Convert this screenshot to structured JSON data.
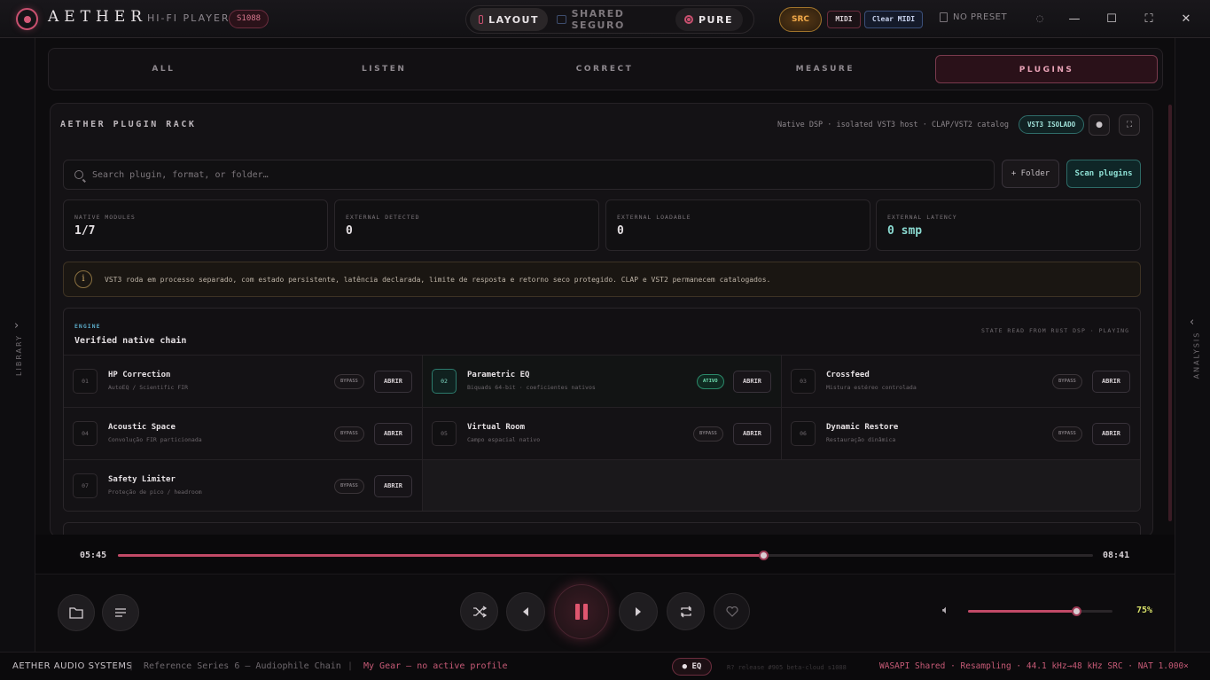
{
  "app": {
    "brand": "AETHER",
    "subtitle": "HI-FI PLAYER",
    "version": "S1088",
    "modes": {
      "layout": "LAYOUT",
      "shared": "SHARED SEGURO",
      "pure": "PURE"
    },
    "src": "SRC",
    "midi": "MIDI",
    "clear_midi": "Clear MIDI",
    "preset": "NO PRESET",
    "window": {
      "minimize": "—",
      "maximize": "☐",
      "fullscreen": "⛶",
      "close": "✕"
    }
  },
  "rails": {
    "left_label": "LIBRARY",
    "right_label": "ANALYSIS"
  },
  "tabs": [
    {
      "label": "ALL",
      "active": false
    },
    {
      "label": "LISTEN",
      "active": false
    },
    {
      "label": "CORRECT",
      "active": false
    },
    {
      "label": "MEASURE",
      "active": false
    },
    {
      "label": "PLUGINS",
      "active": true
    }
  ],
  "rack": {
    "title": "AETHER PLUGIN RACK",
    "meta": "Native DSP · isolated VST3 host · CLAP/VST2 catalog",
    "badge": "VST3 ISOLADO",
    "search_placeholder": "Search plugin, format, or folder…",
    "folder_btn": "+ Folder",
    "scan_btn": "Scan plugins",
    "stats": [
      {
        "label": "NATIVE MODULES",
        "value": "1/7"
      },
      {
        "label": "EXTERNAL DETECTED",
        "value": "0"
      },
      {
        "label": "EXTERNAL LOADABLE",
        "value": "0"
      },
      {
        "label": "EXTERNAL LATENCY",
        "value": "0 smp"
      }
    ],
    "notice": "VST3 roda em processo separado, com estado persistente, latência declarada, limite de resposta e retorno seco protegido. CLAP e VST2 permanecem catalogados.",
    "chain": {
      "eyebrow": "ENGINE",
      "title": "Verified native chain",
      "state": "STATE READ FROM RUST DSP · PLAYING",
      "modules": [
        {
          "num": "01",
          "name": "HP Correction",
          "desc": "AutoEQ / Scientific FIR",
          "status": "BYPASS",
          "open": "ABRIR",
          "active": false
        },
        {
          "num": "02",
          "name": "Parametric EQ",
          "desc": "Biquads 64-bit · coeficientes nativos",
          "status": "ATIVO",
          "open": "ABRIR",
          "active": true
        },
        {
          "num": "03",
          "name": "Crossfeed",
          "desc": "Mistura estéreo controlada",
          "status": "BYPASS",
          "open": "ABRIR",
          "active": false
        },
        {
          "num": "04",
          "name": "Acoustic Space",
          "desc": "Convolução FIR particionada",
          "status": "BYPASS",
          "open": "ABRIR",
          "active": false
        },
        {
          "num": "05",
          "name": "Virtual Room",
          "desc": "Campo espacial nativo",
          "status": "BYPASS",
          "open": "ABRIR",
          "active": false
        },
        {
          "num": "06",
          "name": "Dynamic Restore",
          "desc": "Restauração dinâmica",
          "status": "BYPASS",
          "open": "ABRIR",
          "active": false
        },
        {
          "num": "07",
          "name": "Safety Limiter",
          "desc": "Proteção de pico / headroom",
          "status": "BYPASS",
          "open": "ABRIR",
          "active": false
        }
      ]
    }
  },
  "transport": {
    "elapsed": "05:45",
    "total": "08:41",
    "progress": 0.662,
    "volume": 0.75,
    "volume_label": "75%"
  },
  "status": {
    "brand": "AETHER AUDIO SYSTEMS",
    "series": "Reference Series 6 — Audiophile Chain",
    "gear": "My Gear — no active profile",
    "eq": "● EQ",
    "release": "R? release #905 beta-cloud s1088",
    "audio": "WASAPI Shared · Resampling · 44.1 kHz→48 kHz SRC · NAT 1.000×"
  },
  "colors": {
    "accent": "#c24a67",
    "teal": "#8fe2d6",
    "amber": "#f0a94a",
    "volume": "#d8e069"
  }
}
